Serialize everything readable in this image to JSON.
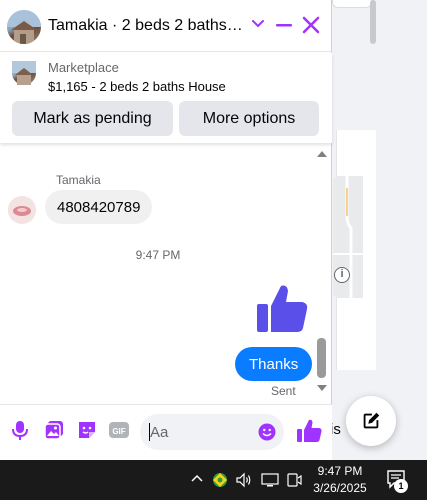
{
  "colors": {
    "accent": "#a033ff",
    "messenger_blue": "#0a7cff",
    "like_blue": "#5b4fe9"
  },
  "chat": {
    "title": "Tamakia · 2 beds 2 baths H...",
    "listing": {
      "label": "Marketplace",
      "title": "$1,165 - 2 beds 2 baths House",
      "mark_pending_label": "Mark as pending",
      "more_options_label": "More options"
    },
    "messages": {
      "sender_name": "Tamakia",
      "incoming_text": "4808420789",
      "timestamp": "9:47 PM",
      "outgoing_text": "Thanks",
      "status": "Sent"
    },
    "composer": {
      "placeholder": "Aa"
    }
  },
  "background": {
    "partial_text": "is"
  },
  "taskbar": {
    "time": "9:47 PM",
    "date": "3/26/2025",
    "notification_count": "1"
  },
  "icons": [
    "chevron-down-icon",
    "minimize-icon",
    "close-icon",
    "microphone-icon",
    "photo-icon",
    "sticker-icon",
    "gif-icon",
    "emoji-icon",
    "thumbs-up-icon",
    "compose-icon",
    "tray-chevron-icon",
    "wifi-icon",
    "volume-icon",
    "network-icon",
    "notification-icon"
  ]
}
